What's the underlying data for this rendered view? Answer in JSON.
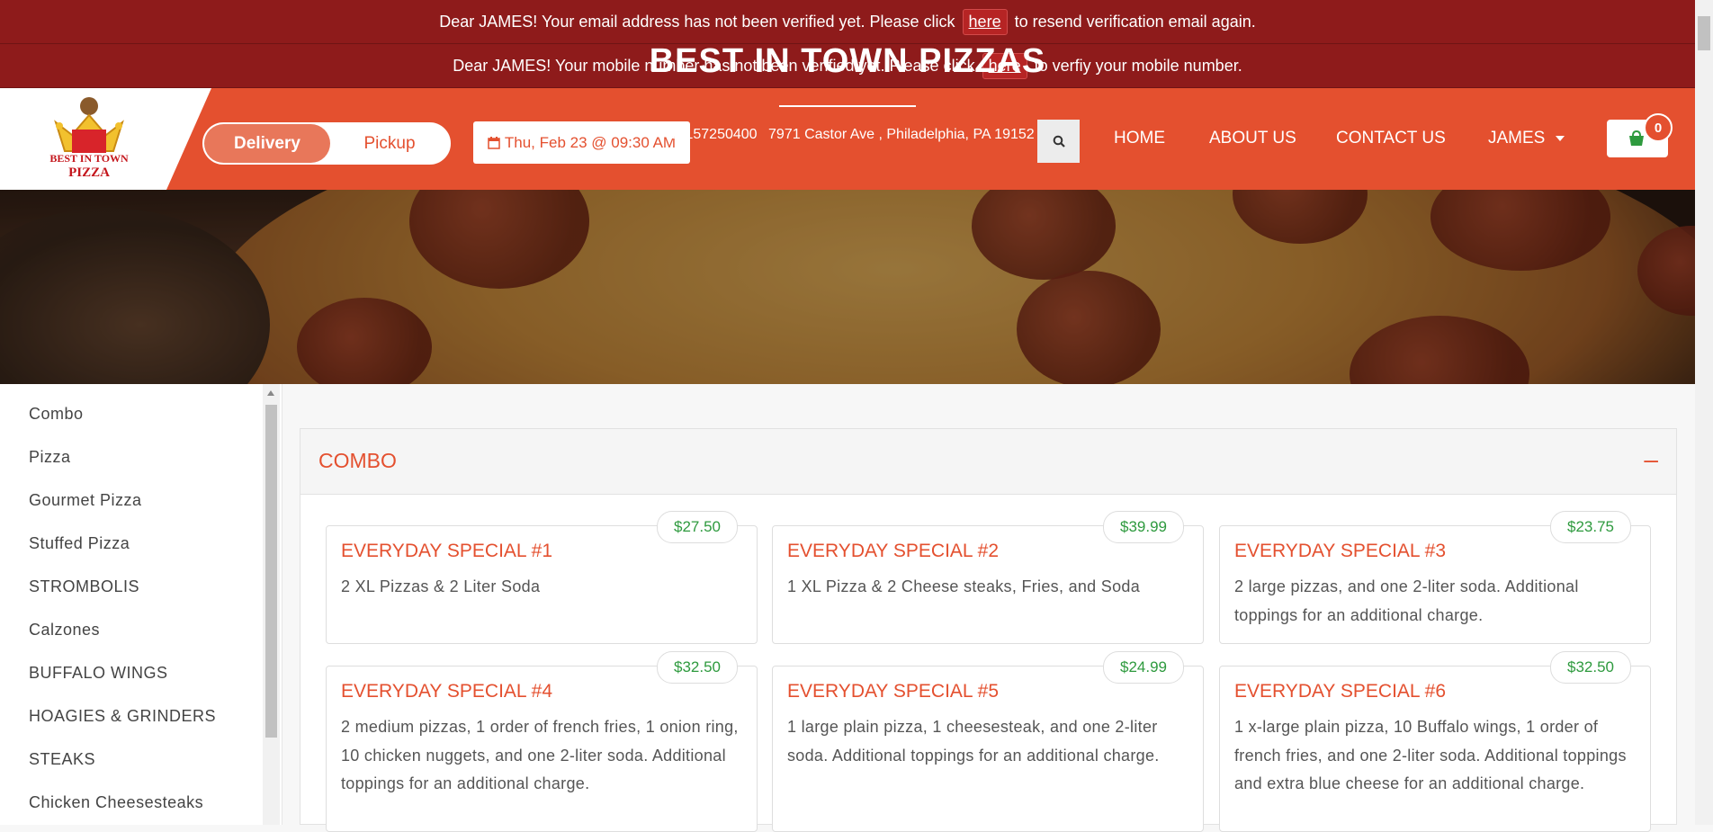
{
  "banners": {
    "email": {
      "before": "Dear JAMES! Your email address has not been verified yet. Please click",
      "link": "here",
      "after": "to resend verification email again."
    },
    "mobile": {
      "before": "Dear JAMES! Your mobile number has not been verified yet. Please click",
      "link": "here",
      "after": "to verfiy your mobile number."
    }
  },
  "header": {
    "logo_text_top": "BEST IN TOWN",
    "logo_text_bottom": "PIZZA",
    "toggle": {
      "delivery": "Delivery",
      "pickup": "Pickup",
      "selected": "Delivery"
    },
    "date": "Thu, Feb 23 @ 09:30 AM",
    "nav": {
      "home": "HOME",
      "about": "ABOUT US",
      "contact": "CONTACT US",
      "user": "JAMES"
    },
    "cart_count": "0",
    "colors": {
      "brand": "#e4502f",
      "banner": "#8e1b1b",
      "price": "#2e9a3e",
      "cart_icon": "#2e9a3e"
    }
  },
  "hero": {
    "title": "BEST IN TOWN PIZZAS",
    "phone": "+12157250400",
    "address": "7971 Castor Ave , Philadelphia, PA 19152"
  },
  "sidebar": {
    "items": [
      "Combo",
      "Pizza",
      "Gourmet Pizza",
      "Stuffed Pizza",
      "STROMBOLIS",
      "Calzones",
      "BUFFALO WINGS",
      "HOAGIES & GRINDERS",
      "STEAKS",
      "Chicken Cheesesteaks"
    ]
  },
  "section": {
    "title": "COMBO",
    "collapse_symbol": "–",
    "items": [
      {
        "name": "EVERYDAY SPECIAL #1",
        "price": "$27.50",
        "desc": "2 XL Pizzas & 2 Liter Soda"
      },
      {
        "name": "EVERYDAY SPECIAL #2",
        "price": "$39.99",
        "desc": "1 XL Pizza & 2 Cheese steaks, Fries, and Soda"
      },
      {
        "name": "EVERYDAY SPECIAL #3",
        "price": "$23.75",
        "desc": "2 large pizzas, and one 2-liter soda. Additional toppings for an additional charge."
      },
      {
        "name": "EVERYDAY SPECIAL #4",
        "price": "$32.50",
        "desc": "2 medium pizzas, 1 order of french fries, 1 onion ring, 10 chicken nuggets, and one 2-liter soda. Additional toppings for an additional charge."
      },
      {
        "name": "EVERYDAY SPECIAL #5",
        "price": "$24.99",
        "desc": "1 large plain pizza, 1 cheesesteak, and one 2-liter soda. Additional toppings for an additional charge."
      },
      {
        "name": "EVERYDAY SPECIAL #6",
        "price": "$32.50",
        "desc": "1 x-large plain pizza, 10 Buffalo wings, 1 order of french fries, and one 2-liter soda. Additional toppings and extra blue cheese for an additional charge."
      }
    ]
  }
}
